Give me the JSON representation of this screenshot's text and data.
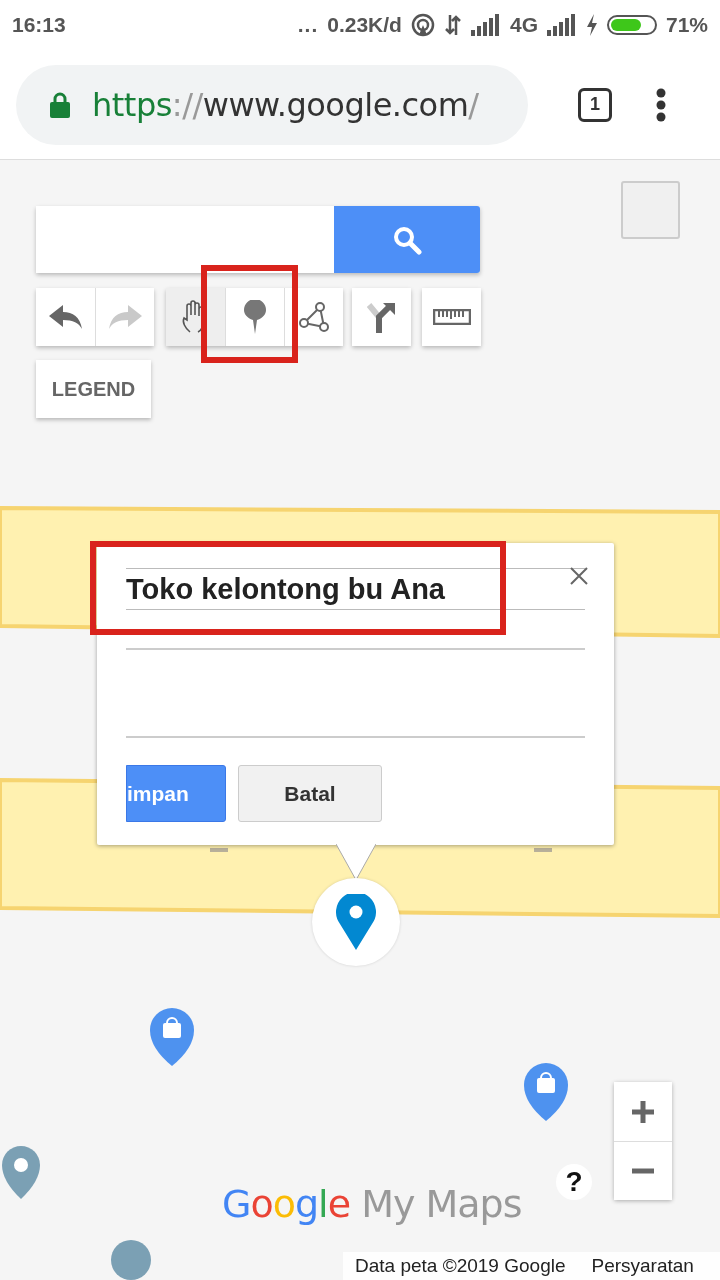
{
  "status_bar": {
    "time": "16:13",
    "more": "...",
    "speed": "0.23K/d",
    "network": "4G",
    "battery": {
      "level": 0.71,
      "percent": "71%"
    }
  },
  "browser": {
    "url": {
      "scheme": "https",
      "separator": "://",
      "host": "www.google.com",
      "path": "/"
    },
    "tab_count": "1"
  },
  "tool_groups": [
    [
      {
        "kind": "undo",
        "selected": false,
        "disabled": false
      },
      {
        "kind": "redo",
        "selected": false,
        "disabled": true
      }
    ],
    [
      {
        "kind": "hand",
        "selected": true,
        "disabled": false
      },
      {
        "kind": "marker",
        "selected": false,
        "disabled": false
      },
      {
        "kind": "line",
        "selected": false,
        "disabled": false
      }
    ],
    [
      {
        "kind": "directions",
        "selected": false,
        "disabled": false
      }
    ],
    [
      {
        "kind": "ruler",
        "selected": false,
        "disabled": false
      }
    ]
  ],
  "legend": "LEGEND",
  "popup": {
    "title_value": "Toko kelontong bu Ana",
    "save": "impan",
    "cancel": "Batal"
  },
  "help": "?",
  "logo": {
    "brand": "Google",
    "product": "My Maps"
  },
  "attribution": {
    "data": "Data peta ©2019 Google",
    "terms": "Persyaratan"
  }
}
